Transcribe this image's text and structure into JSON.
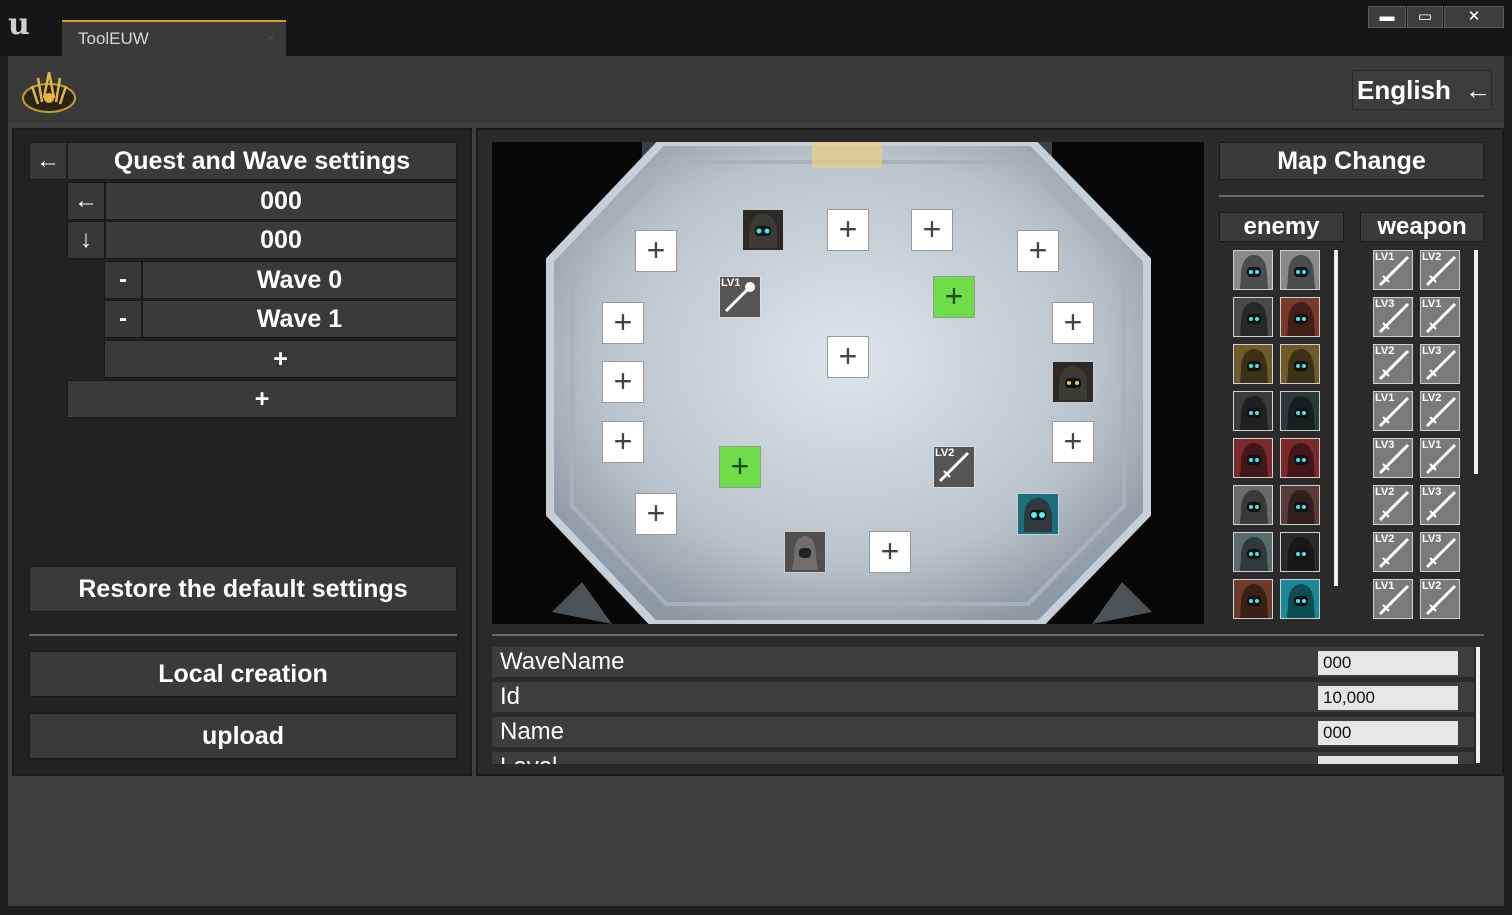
{
  "window": {
    "tab_title": "ToolEUW",
    "tab_close": "×",
    "min": "▬",
    "max": "▭",
    "close": "✕",
    "engine_logo": "u"
  },
  "header": {
    "language": "English",
    "language_arrow": "←"
  },
  "tree": {
    "back_arrow": "←",
    "title": "Quest and Wave settings",
    "quest_arrow": "←",
    "quest_value": "000",
    "down_arrow": "↓",
    "sub_value": "000",
    "waves": [
      {
        "remove": "-",
        "label": "Wave 0"
      },
      {
        "remove": "-",
        "label": "Wave 1"
      }
    ],
    "add_wave": "+",
    "add_quest": "+"
  },
  "actions": {
    "restore": "Restore the default settings",
    "local": "Local creation",
    "upload": "upload"
  },
  "map": {
    "change_label": "Map Change",
    "plus": "+",
    "lv1": "LV1",
    "lv2": "LV2"
  },
  "lists": {
    "enemy_header": "enemy",
    "weapon_header": "weapon",
    "weapon_levels": [
      "LV1",
      "LV2",
      "LV3",
      "LV1",
      "LV2",
      "LV3",
      "LV1",
      "LV2",
      "LV3",
      "LV1",
      "LV2",
      "LV3",
      "LV2",
      "LV3",
      "LV1",
      "LV2"
    ]
  },
  "properties": [
    {
      "label": "WaveName",
      "value": "000"
    },
    {
      "label": "Id",
      "value": "10,000"
    },
    {
      "label": "Name",
      "value": "000"
    },
    {
      "label": "Level",
      "value": ""
    }
  ],
  "colors": {
    "accent": "#d6a21a",
    "green_slot": "#6fdc4a"
  }
}
